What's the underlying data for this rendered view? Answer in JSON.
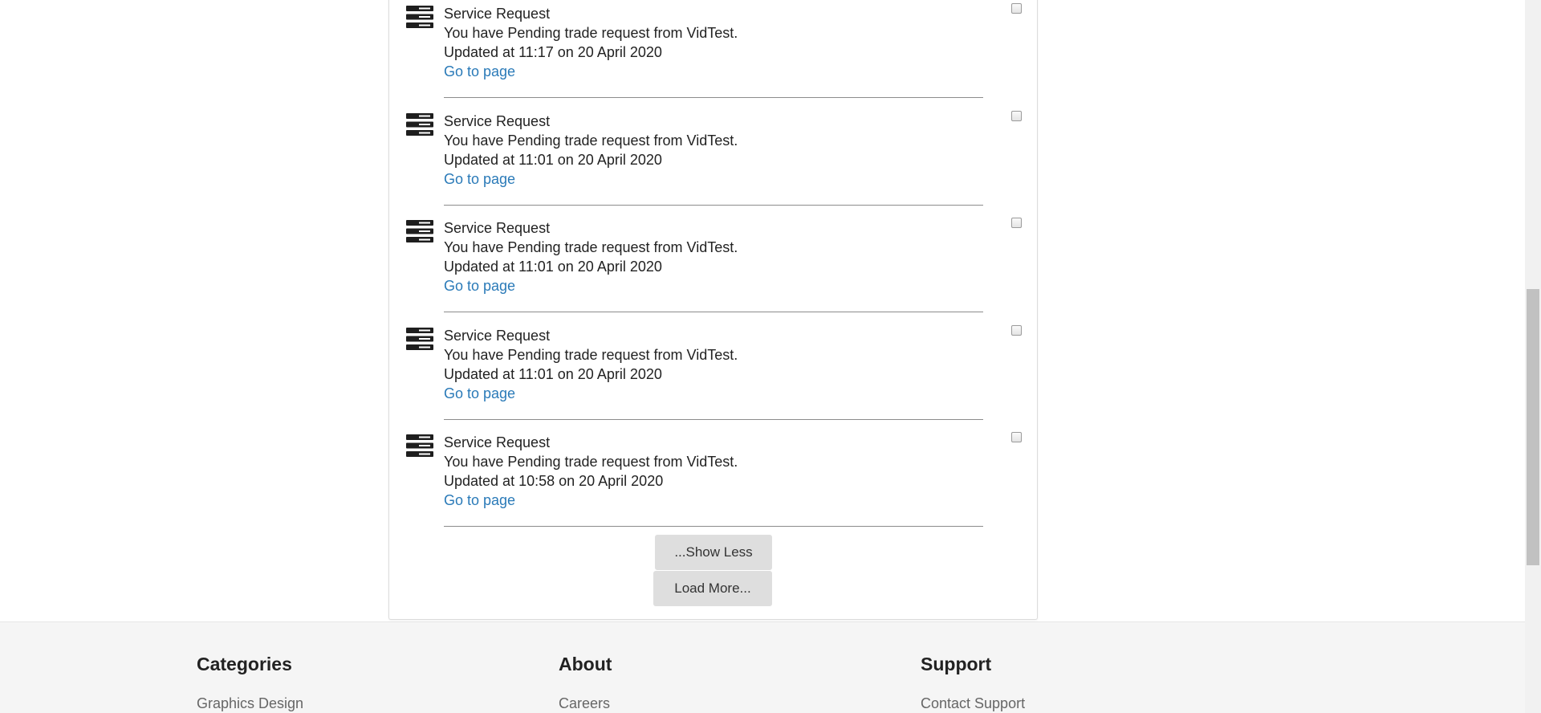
{
  "notifications": [
    {
      "title": "Service Request",
      "message": "You have Pending trade request from VidTest.",
      "updated": "Updated at 11:17 on 20 April 2020",
      "link": "Go to page",
      "icon": "server-stack-icon"
    },
    {
      "title": "Service Request",
      "message": "You have Pending trade request from VidTest.",
      "updated": "Updated at 11:01 on 20 April 2020",
      "link": "Go to page",
      "icon": "server-stack-icon"
    },
    {
      "title": "Service Request",
      "message": "You have Pending trade request from VidTest.",
      "updated": "Updated at 11:01 on 20 April 2020",
      "link": "Go to page",
      "icon": "server-stack-icon"
    },
    {
      "title": "Service Request",
      "message": "You have Pending trade request from VidTest.",
      "updated": "Updated at 11:01 on 20 April 2020",
      "link": "Go to page",
      "icon": "server-stack-icon"
    },
    {
      "title": "Service Request",
      "message": "You have Pending trade request from VidTest.",
      "updated": "Updated at 10:58 on 20 April 2020",
      "link": "Go to page",
      "icon": "server-stack-icon"
    }
  ],
  "actions": {
    "show_less": "...Show Less",
    "load_more": "Load More..."
  },
  "footer": {
    "categories": {
      "heading": "Categories",
      "first_link": "Graphics Design"
    },
    "about": {
      "heading": "About",
      "first_link": "Careers"
    },
    "support": {
      "heading": "Support",
      "first_link": "Contact Support"
    }
  },
  "colors": {
    "link": "#2a7ab8",
    "button_bg": "#dedede",
    "footer_bg": "#f5f5f5",
    "divider": "#8c8c8c"
  }
}
